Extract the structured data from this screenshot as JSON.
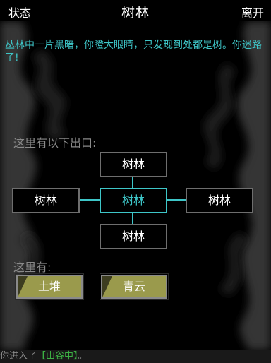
{
  "header": {
    "status_label": "状态",
    "title": "树林",
    "leave_label": "离开"
  },
  "description": "丛林中一片黑暗，你瞪大眼睛，只发现到处都是树。你迷路了!",
  "exits": {
    "label": "这里有以下出口:",
    "north": "树林",
    "west": "树林",
    "center": "树林",
    "east": "树林",
    "south": "树林"
  },
  "objects": {
    "label": "这里有:",
    "items": [
      "土堆",
      "青云"
    ]
  },
  "log": {
    "prefix": "你进入了",
    "open_bracket": "【",
    "location": "山谷中",
    "close_bracket": "】",
    "suffix": "。"
  },
  "colors": {
    "accent": "#3ec6c8",
    "object_fill": "#9a9a4c",
    "location_text": "#3cb043"
  }
}
